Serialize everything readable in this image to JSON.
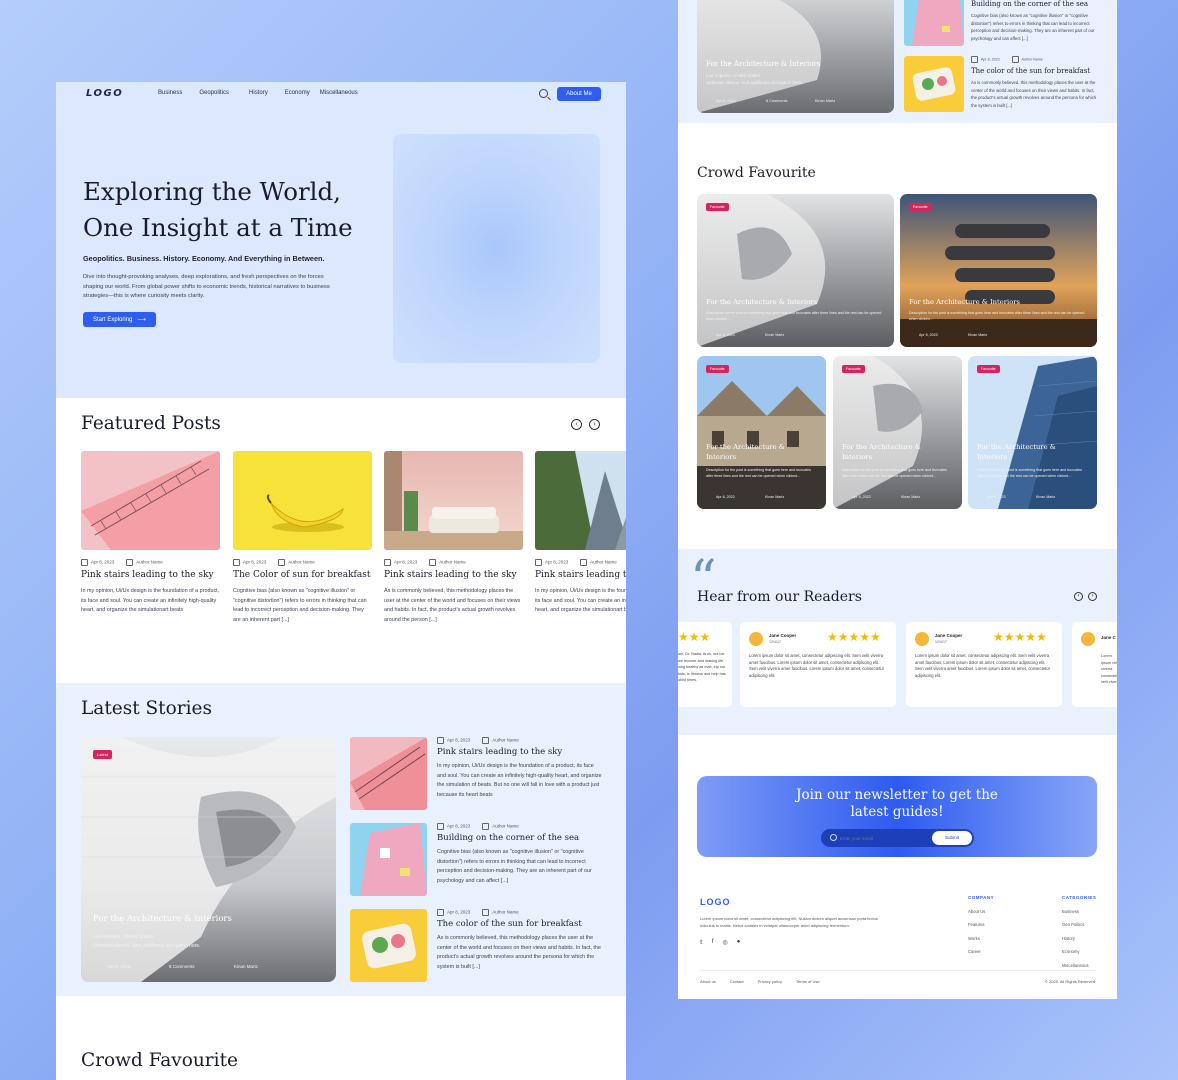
{
  "nav": {
    "logo": "LOGO",
    "links": [
      "Business",
      "Geopolitics",
      "History",
      "Economy",
      "Miscellaneous"
    ],
    "cta": "About Me"
  },
  "hero": {
    "title_line1": "Exploring the World,",
    "title_line2": "One Insight at a Time",
    "tagline": "Geopolitics. Business. History. Economy. And Everything in Between.",
    "intro": "Dive into thought-provoking analyses, deep explorations, and fresh perspectives on the forces shaping our world. From global power shifts to economic trends, historical narratives to business strategies—this is where curiosity meets clarity.",
    "cta": "Start Exploring"
  },
  "featured": {
    "title": "Featured Posts",
    "cards": [
      {
        "date": "Apr 8, 2023",
        "author": "Author Name",
        "title": "Pink stairs leading to the sky",
        "text": "In my opinion, Ui/Ux design is the foundation of a product, its face and soul. You can create an infinitely high-quality heart, and organize the simulationart beats"
      },
      {
        "date": "Apr 8, 2023",
        "author": "Author Name",
        "title": "The Color of sun for breakfast",
        "text": "Cognitive bias (also known as \"cognitive illusion\" or \"cognitive distortion\") refers to errors in thinking that can lead to incorrect perception and decision-making. They are an inherent part [...]"
      },
      {
        "date": "Apr 8, 2023",
        "author": "Author Name",
        "title": "Pink stairs leading to the sky",
        "text": "As is commonly believed, this methodology places the user at the center of the world and focuses on their views and habits. In fact, the product's actual growth revolves around the person [...]"
      },
      {
        "date": "Apr 8, 2023",
        "author": "Author Name",
        "title": "Pink stairs leading to the sky",
        "text": "In my opinion, Ui/Ux design is the foundation of a product, its face and soul. You can create an infinitely high-quality heart, and organize the simulationart beats"
      }
    ]
  },
  "latest": {
    "title": "Latest Stories",
    "big": {
      "badge": "Latest",
      "title": "For the Architecture & Interiors",
      "location": "Los Angeles, United States",
      "desc": "Unknown device. And additional discription here.",
      "date": "Apr 8, 2023",
      "comments": "8 Comments",
      "author": "Kinan Martz"
    },
    "stories": [
      {
        "date": "Apr 8, 2023",
        "author": "Author Name",
        "title": "Pink stairs leading to the sky",
        "text": "In my opinion, Ui/Ux design is the foundation of a product, its face and soul. You can create an infinitely high-quality heart, and organize the simulation of beats. But no one will fall in love with a product just because its heart beats"
      },
      {
        "date": "Apr 8, 2023",
        "author": "Author Name",
        "title": "Building on the corner of the sea",
        "text": "Cognitive bias (also known as \"cognitive illusion\" or \"cognitive distortion\") refers to errors in thinking that can lead to incorrect perception and decision-making. They are an inherent part of our psychology and can affect [...]"
      },
      {
        "date": "Apr 8, 2023",
        "author": "Author Name",
        "title": "The color of the sun for breakfast",
        "text": "As is commonly believed, this methodology places the user at the center of the world and focuses on their views and habits. In fact, the product's actual growth revolves around the persona for which the system is built [...]"
      }
    ]
  },
  "crowd_left_title": "Crowd Favourite",
  "right": {
    "top_big": {
      "title": "For the Architecture & Interiors",
      "location": "Los Angeles, United States",
      "desc": "Unknown device. And additional discription here.",
      "date": "Apr 8, 2023",
      "comments": "8 Comments",
      "author": "Kinan Martz"
    },
    "top_stories": [
      {
        "title": "Building on the corner of the sea",
        "text": "Cognitive bias (also known as \"cognitive illusion\" or \"cognitive distortion\") refers to errors in thinking that can lead to incorrect perception and decision-making. They are an inherent part of our psychology and can affect [...]"
      },
      {
        "date": "Apr 8, 2023",
        "author": "Author Name",
        "title": "The color of the sun for breakfast",
        "text": "As is commonly believed, this methodology places the user at the center of the world and focuses on their views and habits. In fact, the product's actual growth revolves around the persona for which the system is built [...]"
      }
    ],
    "crowd_title": "Crowd Favourite",
    "crowd_cards": [
      {
        "badge": "Favourite",
        "title": "For the Architecture & Interiors",
        "desc": "Description for the post is something that goes here and truncates after three lines and the rest can be opened when clicked...",
        "date": "Apr 8, 2023",
        "author": "Kinan Martz"
      },
      {
        "badge": "Favourite",
        "title": "For the Architecture & Interiors",
        "desc": "Description for the post is something that goes here and truncates after three lines and the rest can be opened when clicked...",
        "date": "Apr 8, 2023",
        "author": "Kinan Martz"
      },
      {
        "badge": "Favourite",
        "title": "For the Architecture & Interiors",
        "desc": "Description for the post is something that goes here and truncates after three lines and the rest can be opened when clicked...",
        "date": "Apr 8, 2023",
        "author": "Kinan Martz"
      },
      {
        "badge": "Favourite",
        "title": "For the Architecture & Interiors",
        "desc": "Description for the post is something that goes here and truncates after three lines and the rest can be opened when clicked...",
        "date": "Apr 8, 2023",
        "author": "Kinan Martz"
      },
      {
        "badge": "Favourite",
        "title": "For the Architecture & Interiors",
        "desc": "Description for the post is something that goes here and truncates after three lines and the rest can be opened when clicked...",
        "date": "Apr 8, 2023",
        "author": "Kinan Martz"
      }
    ],
    "readers_title": "Hear from our Readers",
    "reviews": [
      {
        "name": "Jane Cooper",
        "date": "12/4/17",
        "text": "Lorem ipsum dolor sit amet, consectetur adipiscing elit. Sem velit viverra amet faucibus. Lorem ipsum dolor sit amet, consectetur adipiscing elit. Sem velit viverra amet faucibus. Lorem ipsum dolor sit amet, consectetur adipiscing elit."
      },
      {
        "name": "Jane Cooper",
        "date": "12/4/17",
        "text": "Lorem ipsum dolor sit amet, consectetur adipiscing elit. Sem velit viverra amet faucibus. Lorem ipsum dolor sit amet, consectetur adipiscing elit. Sem velit viverra amet faucibus. Lorem ipsum dolor sit amet, consectetur adipiscing elit."
      }
    ],
    "review_partial_left": "uni, Dr. Nadia, Aron, ma ive we recover and making life ving healthy as ever, elp our kids, is Ithness and help has ublid times.",
    "review_partial_right_name": "Jane C",
    "review_partial_right_text": "Lorem ipsum velit viverra consectetur velit viverra",
    "newsletter": {
      "title": "Join our newsletter to get the latest guides!",
      "placeholder": "Enter your email",
      "button": "Submit"
    },
    "footer": {
      "logo": "LOGO",
      "about": "Lorem ipsum dolor sit amet, consectetur adipiscing elit. Nullam dictum aliquet accumsan porta lectus ridiculus in mattis. Netus sodales in volutpat ullamcorper amet adipiscing fermentum.",
      "company_title": "COMPANY",
      "company": [
        "About Us",
        "Features",
        "Works",
        "Career"
      ],
      "categories_title": "CATEGORIES",
      "categories": [
        "Business",
        "Geo Politics",
        "History",
        "Economy",
        "Miscellaneous"
      ],
      "bottom_links": [
        "About us",
        "Contact",
        "Privacy policy",
        "Terms of Use"
      ],
      "copyright": "© 2025. All Rights Reserved"
    }
  }
}
